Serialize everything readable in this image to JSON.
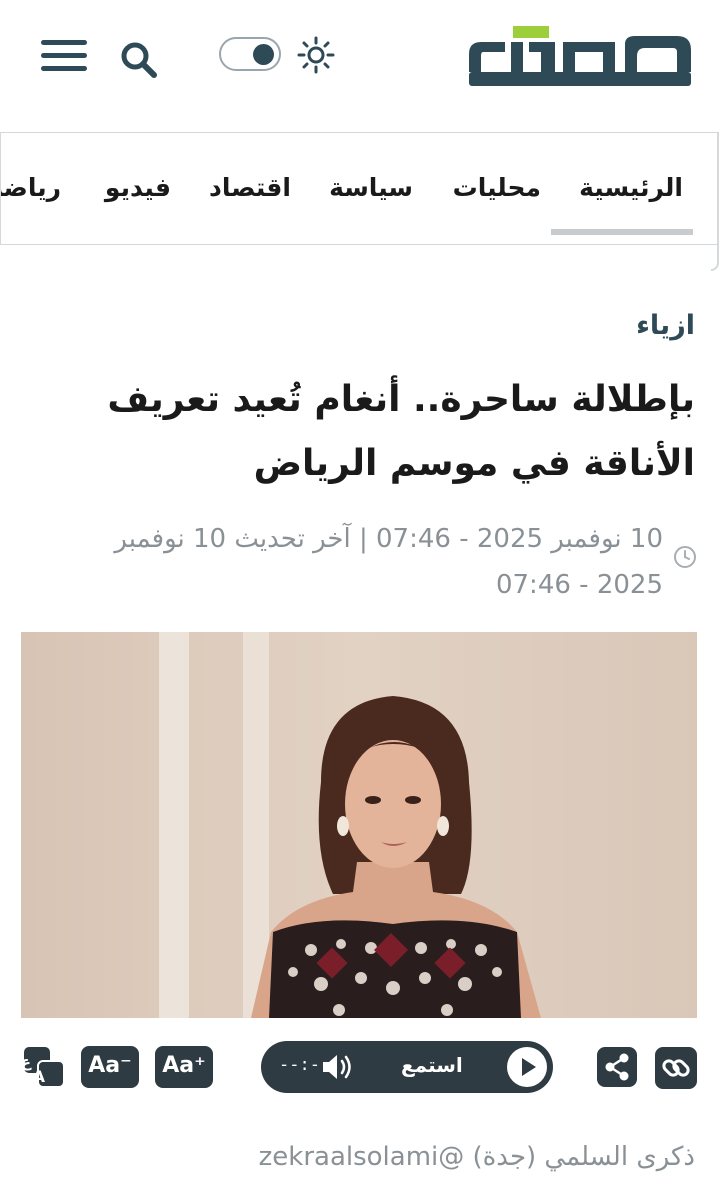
{
  "header": {
    "logo_text": "عكاظ",
    "colors": {
      "brand_dark": "#2f4a57",
      "brand_accent": "#9ccf3b"
    },
    "icons": [
      "menu-icon",
      "search-icon",
      "theme-toggle",
      "sun-icon"
    ]
  },
  "nav": {
    "items": [
      {
        "label": "الرئيسية",
        "active": true
      },
      {
        "label": "محليات"
      },
      {
        "label": "سياسة"
      },
      {
        "label": "اقتصاد"
      },
      {
        "label": "فيديو"
      },
      {
        "label": "رياضة"
      }
    ]
  },
  "article": {
    "category": "ازياء",
    "headline": "بإطلالة ساحرة.. أنغام تُعيد تعريف الأناقة في موسم الرياض",
    "meta": "10 نوفمبر 2025 - 07:46 | آخر تحديث 10 نوفمبر 2025 - 07:46",
    "author": "ذكرى السلمي (جدة) @zekraalsolami"
  },
  "toolbar": {
    "font_minus_label": "Aa⁻",
    "font_plus_label": "Aa⁺",
    "listen_label": "استمع",
    "time": "--:--"
  }
}
